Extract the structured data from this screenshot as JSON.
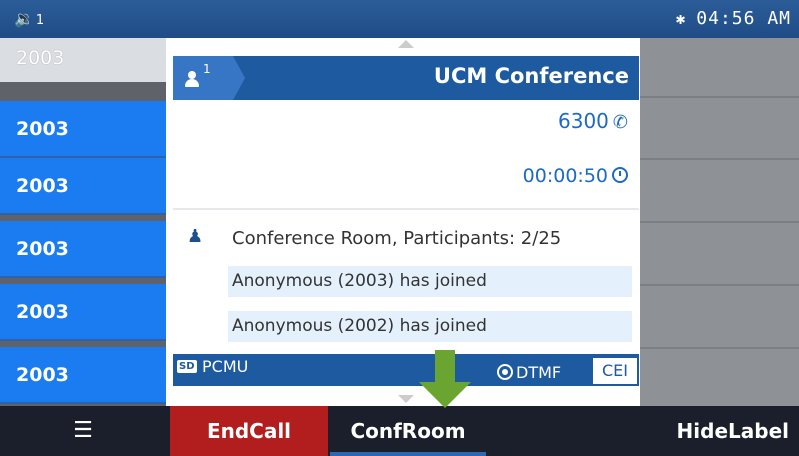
{
  "status_bar": {
    "volume_icon": "speaker-icon",
    "volume_index": "1",
    "bluetooth_icon": "bluetooth-icon",
    "time": "04:56 AM"
  },
  "line_keys": [
    "2003",
    "2003",
    "2003",
    "2003",
    "2003",
    "2003"
  ],
  "call_panel": {
    "user_count": "1",
    "title": "UCM Conference",
    "number": "6300",
    "timer": "00:00:50",
    "conference_line": "Conference Room, Participants: 2/25",
    "events": [
      "Anonymous (2003) has joined",
      "Anonymous (2002) has joined"
    ],
    "hd_badge": "SD",
    "codec": "PCMU",
    "dtmf": "DTMF",
    "cei": "CEI"
  },
  "softkeys": {
    "menu_icon": "menu-icon",
    "end_call": "EndCall",
    "conf_room": "ConfRoom",
    "hide_label": "HideLabel"
  },
  "colors": {
    "status_bar": "#1f4c86",
    "line_key_active": "#1b7bf1",
    "end_call": "#b21d1d",
    "annotation_arrow": "#6aa532"
  }
}
